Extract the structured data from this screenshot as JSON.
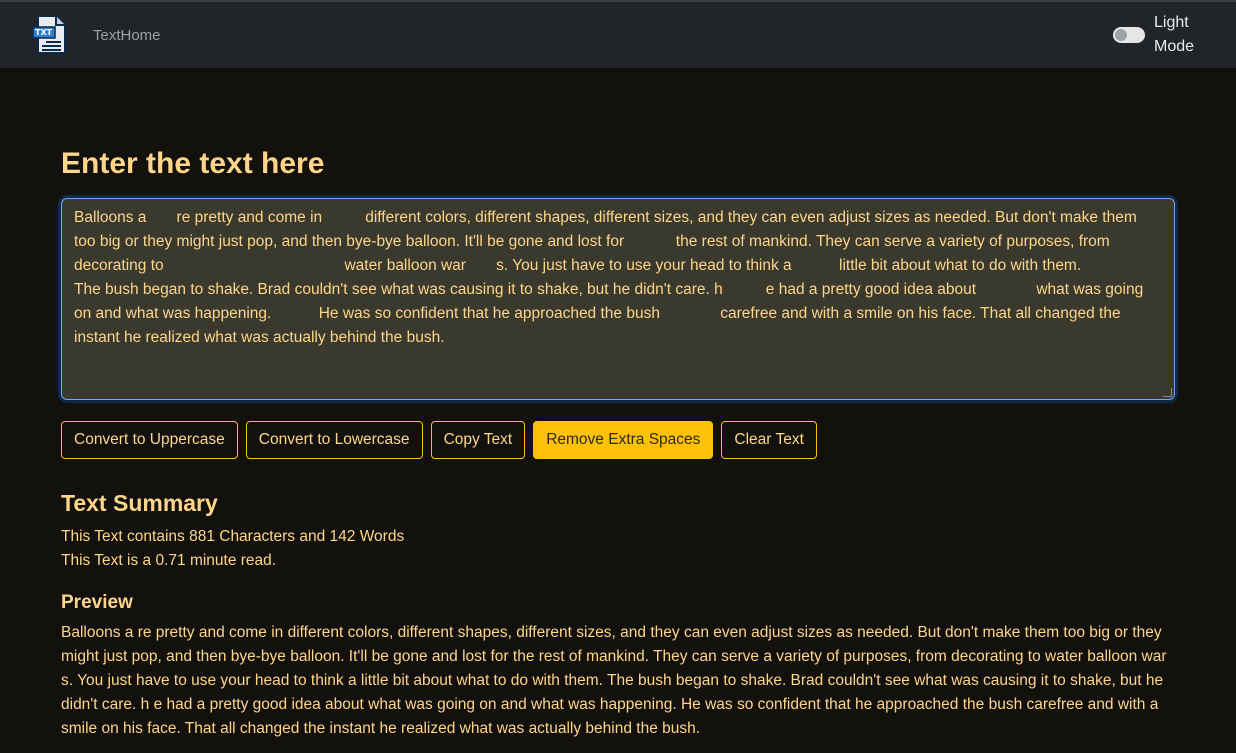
{
  "navbar": {
    "brand": "TextHome",
    "logo_text": "TXT",
    "mode_label": "Light Mode"
  },
  "main": {
    "heading": "Enter the text here",
    "textarea_value": "Balloons a       re pretty and come in          different colors, different shapes, different sizes, and they can even adjust sizes as needed. But don't make them too big or they might just pop, and then bye-bye balloon. It'll be gone and lost for            the rest of mankind. They can serve a variety of purposes, from decorating to                                          water balloon war       s. You just have to use your head to think a           little bit about what to do with them.\nThe bush began to shake. Brad couldn't see what was causing it to shake, but he didn't care. h          e had a pretty good idea about              what was going on and what was happening.           He was so confident that he approached the bush              carefree and with a smile on his face. That all changed the instant he realized what was actually behind the bush.",
    "buttons": [
      {
        "label": "Convert to Uppercase",
        "name": "convert-uppercase-button"
      },
      {
        "label": "Convert to Lowercase",
        "name": "convert-lowercase-button"
      },
      {
        "label": "Copy Text",
        "name": "copy-text-button"
      },
      {
        "label": "Remove Extra Spaces",
        "name": "remove-extra-spaces-button"
      },
      {
        "label": "Clear Text",
        "name": "clear-text-button"
      }
    ]
  },
  "summary": {
    "heading": "Text Summary",
    "counts_line": "This Text contains 881 Characters and 142 Words",
    "read_line": "This Text is a 0.71 minute read.",
    "preview_heading": "Preview",
    "preview_text": "Balloons a re pretty and come in different colors, different shapes, different sizes, and they can even adjust sizes as needed. But don't make them too big or they might just pop, and then bye-bye balloon. It'll be gone and lost for the rest of mankind. They can serve a variety of purposes, from decorating to water balloon war s. You just have to use your head to think a little bit about what to do with them. The bush began to shake. Brad couldn't see what was causing it to shake, but he didn't care. h e had a pretty good idea about what was going on and what was happening. He was so confident that he approached the bush carefree and with a smile on his face. That all changed the instant he realized what was actually behind the bush."
  },
  "colors": {
    "accent": "#ffc107",
    "text": "#ffd58a",
    "background": "#13110d",
    "navbar": "#212529"
  },
  "icons": {
    "logo": "txt-file-icon"
  }
}
